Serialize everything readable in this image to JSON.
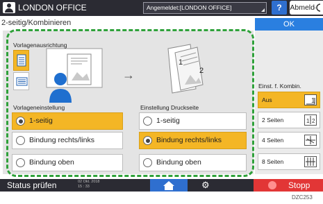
{
  "header": {
    "title": "LONDON OFFICE",
    "login_status": "Angemeldet:[LONDON OFFICE]",
    "help_label": "?",
    "logout_label": "Abmelden"
  },
  "page": {
    "title": "2-seitig/Kombinieren",
    "ok_label": "OK"
  },
  "orientation": {
    "label": "Vorlagenausrichtung",
    "arrow": "→"
  },
  "original_setting": {
    "label": "Vorlageneinstellung",
    "options": [
      {
        "label": "1-seitig",
        "selected": true
      },
      {
        "label": "Bindung rechts/links",
        "selected": false
      },
      {
        "label": "Bindung oben",
        "selected": false
      }
    ]
  },
  "print_setting": {
    "label": "Einstellung Druckseite",
    "options": [
      {
        "label": "1-seitig",
        "selected": false
      },
      {
        "label": "Bindung rechts/links",
        "selected": true
      },
      {
        "label": "Bindung oben",
        "selected": false
      }
    ]
  },
  "combine": {
    "label": "Einst. f. Kombin.",
    "options": [
      {
        "label": "Aus",
        "selected": true
      },
      {
        "label": "2 Seiten",
        "selected": false
      },
      {
        "label": "4 Seiten",
        "selected": false
      },
      {
        "label": "8 Seiten",
        "selected": false
      }
    ]
  },
  "preview": {
    "page_numbers": [
      "1",
      "2"
    ]
  },
  "footer": {
    "status_label": "Status prüfen",
    "date_line1": "02 Okt. 2018",
    "date_line2": "15 : 33",
    "stop_label": "Stopp"
  },
  "figure_code": "DZC253",
  "colors": {
    "selected": "#f4b625",
    "highlight": "#2fa13a",
    "accent": "#2a7fe0",
    "stop": "#e23636"
  }
}
